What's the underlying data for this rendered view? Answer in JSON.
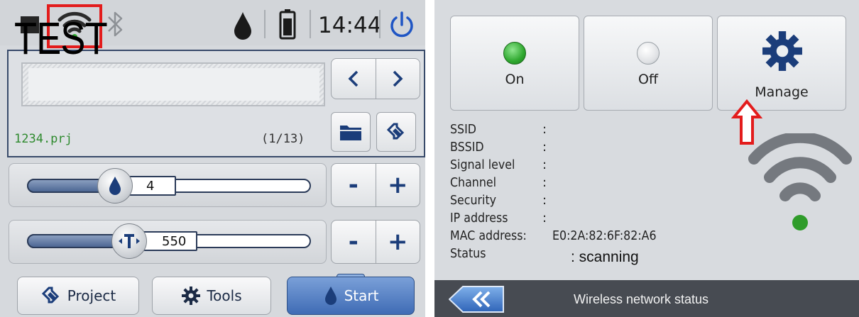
{
  "status_bar": {
    "icons": [
      "stop-icon",
      "wifi-icon",
      "bluetooth-icon",
      "ink-drop-icon",
      "battery-icon",
      "power-icon"
    ],
    "clock": "14:44",
    "highlight_color": "#e31c1c"
  },
  "message": {
    "text": "TEST",
    "file_name": "1234.prj",
    "file_counter": "(1/13)"
  },
  "sliders": {
    "ink": {
      "icon": "ink-drop-icon",
      "value": "4",
      "level": 0.2
    },
    "speed": {
      "icon": "text-width-icon",
      "value": "550",
      "level": 0.25
    }
  },
  "stepper": {
    "minus": "-",
    "plus": "+"
  },
  "bottom_bar": {
    "project_label": "Project",
    "tools_label": "Tools",
    "start_label": "Start"
  },
  "wireless": {
    "buttons": {
      "on_label": "On",
      "off_label": "Off",
      "manage_label": "Manage"
    },
    "led_on_color": "#2fa82f",
    "info_labels": [
      "SSID",
      "BSSID",
      "Signal level",
      "Channel",
      "Security",
      "IP address",
      "MAC address:",
      "Status"
    ],
    "mac_address": "E0:2A:82:6F:82:A6",
    "status_value": ": scanning",
    "signal_dot_color": "#2f9c2a"
  },
  "footer": {
    "back_icon": "double-chevron-left-icon",
    "title": "Wireless network status"
  },
  "annotation": {
    "arrow_color": "#e31c1c"
  }
}
